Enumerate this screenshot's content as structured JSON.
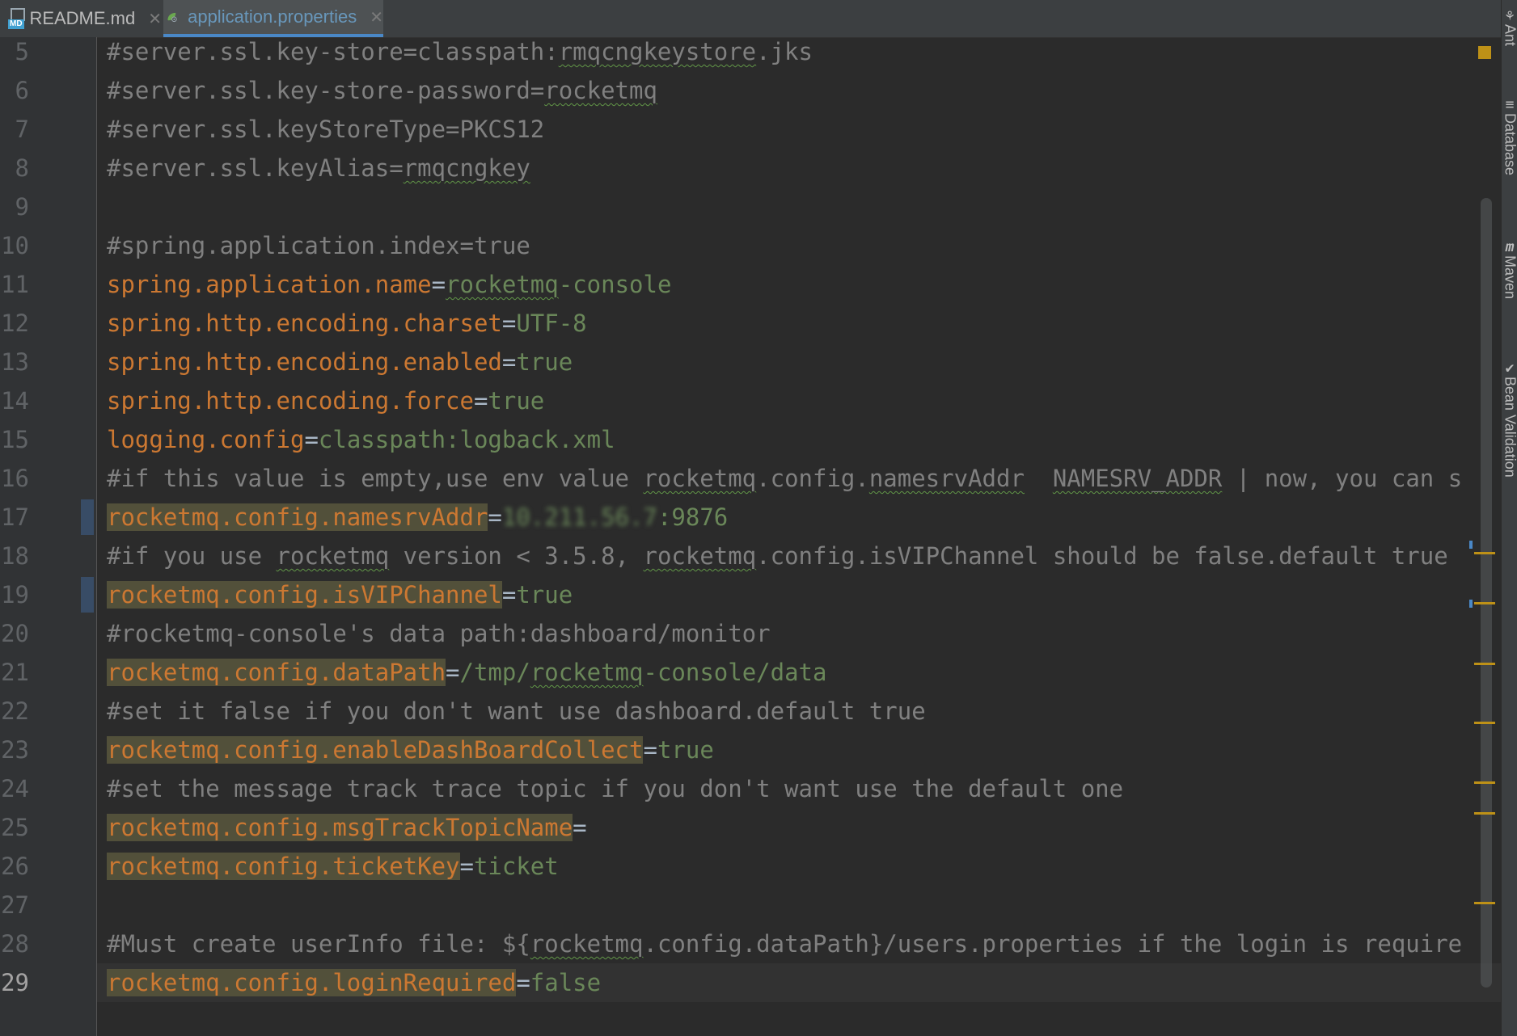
{
  "tabs": [
    {
      "label": "README.md",
      "active": false,
      "icon": "markdown-file-icon",
      "icon_badge": "MD"
    },
    {
      "label": "application.properties",
      "active": true,
      "icon": "spring-leaf-icon"
    }
  ],
  "close_glyph": "✕",
  "right_panels": [
    {
      "label": "Ant",
      "icon": "ant-icon"
    },
    {
      "label": "Database",
      "icon": "database-icon"
    },
    {
      "label": "Maven",
      "icon": "maven-icon"
    },
    {
      "label": "Bean Validation",
      "icon": "bean-validation-icon"
    }
  ],
  "current_line": 29,
  "lines": [
    {
      "n": "5",
      "segs": [
        {
          "c": "cmt",
          "t": "#server.ssl.key-store=classpath:"
        },
        {
          "c": "cmt typo",
          "t": "rmqcngkeystore"
        },
        {
          "c": "cmt",
          "t": ".jks"
        }
      ]
    },
    {
      "n": "6",
      "segs": [
        {
          "c": "cmt",
          "t": "#server.ssl.key-store-password="
        },
        {
          "c": "cmt typo",
          "t": "rocketmq"
        }
      ]
    },
    {
      "n": "7",
      "segs": [
        {
          "c": "cmt",
          "t": "#server.ssl.keyStoreType=PKCS12"
        }
      ]
    },
    {
      "n": "8",
      "segs": [
        {
          "c": "cmt",
          "t": "#server.ssl.keyAlias="
        },
        {
          "c": "cmt typo",
          "t": "rmqcngkey"
        }
      ]
    },
    {
      "n": "9",
      "segs": []
    },
    {
      "n": "10",
      "segs": [
        {
          "c": "cmt",
          "t": "#spring.application.index=true"
        }
      ]
    },
    {
      "n": "11",
      "segs": [
        {
          "c": "key",
          "t": "spring.application.name"
        },
        {
          "c": "eq",
          "t": "="
        },
        {
          "c": "val typo",
          "t": "rocketmq"
        },
        {
          "c": "val",
          "t": "-console"
        }
      ]
    },
    {
      "n": "12",
      "segs": [
        {
          "c": "key",
          "t": "spring.http.encoding.charset"
        },
        {
          "c": "eq",
          "t": "="
        },
        {
          "c": "val",
          "t": "UTF-8"
        }
      ]
    },
    {
      "n": "13",
      "segs": [
        {
          "c": "key",
          "t": "spring.http.encoding.enabled"
        },
        {
          "c": "eq",
          "t": "="
        },
        {
          "c": "val",
          "t": "true"
        }
      ]
    },
    {
      "n": "14",
      "segs": [
        {
          "c": "key",
          "t": "spring.http.encoding.force"
        },
        {
          "c": "eq",
          "t": "="
        },
        {
          "c": "val",
          "t": "true"
        }
      ]
    },
    {
      "n": "15",
      "segs": [
        {
          "c": "key",
          "t": "logging.config"
        },
        {
          "c": "eq",
          "t": "="
        },
        {
          "c": "val",
          "t": "classpath:logback.xml"
        }
      ]
    },
    {
      "n": "16",
      "segs": [
        {
          "c": "cmt",
          "t": "#if this value is empty,use env value "
        },
        {
          "c": "cmt typo",
          "t": "rocketmq"
        },
        {
          "c": "cmt",
          "t": ".config."
        },
        {
          "c": "cmt typo",
          "t": "namesrvAddr"
        },
        {
          "c": "cmt",
          "t": "  "
        },
        {
          "c": "cmt typo",
          "t": "NAMESRV_ADDR"
        },
        {
          "c": "cmt",
          "t": " | now, you can s"
        }
      ]
    },
    {
      "n": "17",
      "segs": [
        {
          "c": "key hl",
          "t": "rocketmq.config.namesrvAddr"
        },
        {
          "c": "eq",
          "t": "="
        },
        {
          "c": "val blur",
          "t": "10.211.56.7"
        },
        {
          "c": "val",
          "t": ":9876"
        }
      ],
      "changed": true
    },
    {
      "n": "18",
      "segs": [
        {
          "c": "cmt",
          "t": "#if you use "
        },
        {
          "c": "cmt typo",
          "t": "rocketmq"
        },
        {
          "c": "cmt",
          "t": " version < 3.5.8, "
        },
        {
          "c": "cmt typo",
          "t": "rocketmq"
        },
        {
          "c": "cmt",
          "t": ".config.isVIPChannel should be false.default true"
        }
      ]
    },
    {
      "n": "19",
      "segs": [
        {
          "c": "key hl",
          "t": "rocketmq.config.isVIPChannel"
        },
        {
          "c": "eq",
          "t": "="
        },
        {
          "c": "val",
          "t": "true"
        }
      ],
      "changed": true
    },
    {
      "n": "20",
      "segs": [
        {
          "c": "cmt",
          "t": "#rocketmq-console's data path:dashboard/monitor"
        }
      ]
    },
    {
      "n": "21",
      "segs": [
        {
          "c": "key hl",
          "t": "rocketmq.config.dataPath"
        },
        {
          "c": "eq",
          "t": "="
        },
        {
          "c": "val",
          "t": "/tmp/"
        },
        {
          "c": "val typo",
          "t": "rocketmq"
        },
        {
          "c": "val",
          "t": "-console/data"
        }
      ]
    },
    {
      "n": "22",
      "segs": [
        {
          "c": "cmt",
          "t": "#set it false if you don't want use dashboard.default true"
        }
      ]
    },
    {
      "n": "23",
      "segs": [
        {
          "c": "key hl",
          "t": "rocketmq.config.enableDashBoardCollect"
        },
        {
          "c": "eq",
          "t": "="
        },
        {
          "c": "val",
          "t": "true"
        }
      ]
    },
    {
      "n": "24",
      "segs": [
        {
          "c": "cmt",
          "t": "#set the message track trace topic if you don't want use the default one"
        }
      ]
    },
    {
      "n": "25",
      "segs": [
        {
          "c": "key hl",
          "t": "rocketmq.config.msgTrackTopicName"
        },
        {
          "c": "eq",
          "t": "="
        }
      ]
    },
    {
      "n": "26",
      "segs": [
        {
          "c": "key hl",
          "t": "rocketmq.config.ticketKey"
        },
        {
          "c": "eq",
          "t": "="
        },
        {
          "c": "val",
          "t": "ticket"
        }
      ]
    },
    {
      "n": "27",
      "segs": []
    },
    {
      "n": "28",
      "segs": [
        {
          "c": "cmt",
          "t": "#Must create userInfo file: ${"
        },
        {
          "c": "cmt typo",
          "t": "rocketmq"
        },
        {
          "c": "cmt",
          "t": ".config.dataPath}/users.properties if the login is require"
        }
      ]
    },
    {
      "n": "29",
      "segs": [
        {
          "c": "key hl",
          "t": "rocketmq.config.loginRequired"
        },
        {
          "c": "eq",
          "t": "="
        },
        {
          "c": "val",
          "t": "false"
        }
      ]
    }
  ],
  "colors": {
    "background": "#2b2b2b",
    "comment": "#808080",
    "key": "#cc7832",
    "value": "#6a8759",
    "unused_key_highlight": "#52503a",
    "line_number": "#606366",
    "active_tab_text": "#6897bb"
  }
}
